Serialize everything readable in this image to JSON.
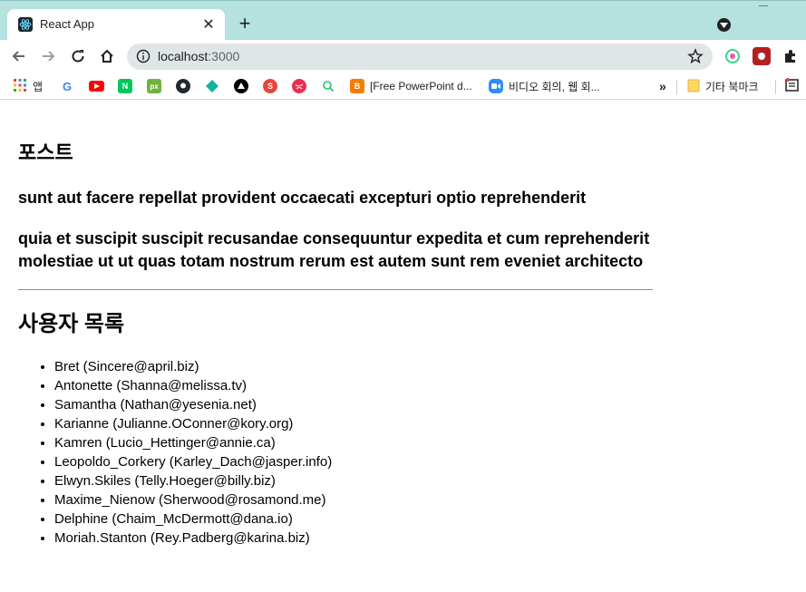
{
  "browser": {
    "tab_title": "React App",
    "url_host": "localhost",
    "url_port": ":3000",
    "accent": "#b5e1de"
  },
  "bookmarks": {
    "apps_label": "앱",
    "items": [
      {
        "icon": "google-icon",
        "color": "#ffffff"
      },
      {
        "icon": "youtube-icon",
        "color": "#ff0000"
      },
      {
        "icon": "naver-icon",
        "color": "#03c75a"
      },
      {
        "icon": "px-icon",
        "color": "#6fb33f"
      },
      {
        "icon": "github-icon",
        "color": "#24292e"
      },
      {
        "icon": "diamond-icon",
        "color": "#13b3a0"
      },
      {
        "icon": "triangle-icon",
        "color": "#000000"
      },
      {
        "icon": "s-icon",
        "color": "#e8453c"
      },
      {
        "icon": "ball-icon",
        "color": "#e8304e"
      },
      {
        "icon": "search-q-icon",
        "color": "#25c16f"
      }
    ],
    "blogger_label": "[Free PowerPoint d...",
    "zoom_label": "비디오 회의, 웹 회...",
    "more_label": "»",
    "other_label": "기타 북마크"
  },
  "page": {
    "posts_heading": "포스트",
    "posts": [
      {
        "title": "sunt aut facere repellat provident occaecati excepturi optio reprehenderit"
      },
      {
        "title": "quia et suscipit suscipit recusandae consequuntur expedita et cum reprehenderit molestiae ut ut quas totam nostrum rerum est autem sunt rem eveniet architecto"
      }
    ],
    "users_heading": "사용자 목록",
    "users": [
      {
        "entry": "Bret (Sincere@april.biz)"
      },
      {
        "entry": "Antonette (Shanna@melissa.tv)"
      },
      {
        "entry": "Samantha (Nathan@yesenia.net)"
      },
      {
        "entry": "Karianne (Julianne.OConner@kory.org)"
      },
      {
        "entry": "Kamren (Lucio_Hettinger@annie.ca)"
      },
      {
        "entry": "Leopoldo_Corkery (Karley_Dach@jasper.info)"
      },
      {
        "entry": "Elwyn.Skiles (Telly.Hoeger@billy.biz)"
      },
      {
        "entry": "Maxime_Nienow (Sherwood@rosamond.me)"
      },
      {
        "entry": "Delphine (Chaim_McDermott@dana.io)"
      },
      {
        "entry": "Moriah.Stanton (Rey.Padberg@karina.biz)"
      }
    ]
  }
}
